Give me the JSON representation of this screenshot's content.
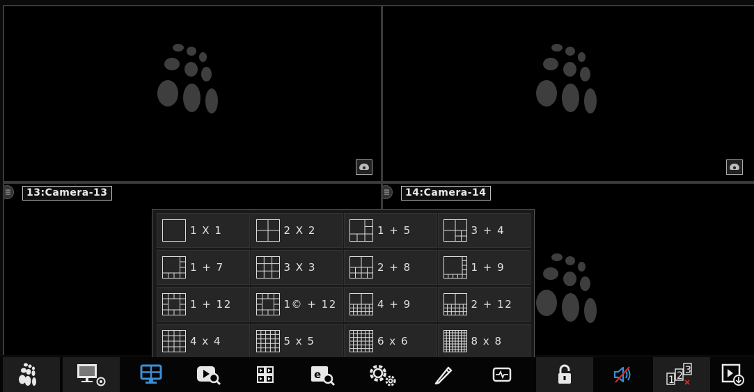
{
  "cameras": [
    {
      "label": ""
    },
    {
      "label": ""
    },
    {
      "label": "13:Camera-13"
    },
    {
      "label": "14:Camera-14"
    }
  ],
  "layout_menu": {
    "options": [
      [
        "1 X 1",
        "2 X 2",
        "1 + 5",
        "3 + 4"
      ],
      [
        "1 + 7",
        "3 X 3",
        "2 + 8",
        "1 + 9"
      ],
      [
        "1 + 12",
        "1© + 12",
        "4 + 9",
        "2 + 12"
      ],
      [
        "4 x 4",
        "5 x 5",
        "6 x 6",
        "8 x 8"
      ]
    ]
  },
  "taskbar": {
    "buttons": [
      {
        "icon": "logo-icon"
      },
      {
        "icon": "display-settings-icon"
      },
      {
        "icon": "layout-monitor-icon"
      },
      {
        "icon": "playback-search-icon"
      },
      {
        "icon": "sequence-icon"
      },
      {
        "icon": "event-search-icon"
      },
      {
        "icon": "settings-gears-icon"
      },
      {
        "icon": "edit-pencil-icon"
      },
      {
        "icon": "system-status-icon"
      },
      {
        "icon": "lock-icon"
      },
      {
        "icon": "mute-icon"
      },
      {
        "icon": "channel-number-icon"
      },
      {
        "icon": "backup-icon"
      }
    ]
  },
  "colors": {
    "background": "#000000",
    "divider": "#3a3a3a",
    "accent_blue": "#3a8fd6",
    "mute_red": "#d42a2a",
    "logo_gray": "#3e3e3e"
  }
}
